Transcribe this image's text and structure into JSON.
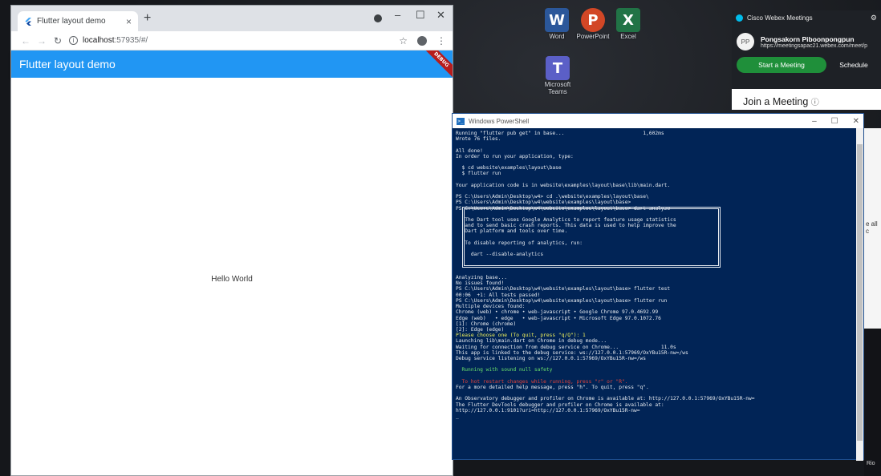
{
  "chrome": {
    "tab_title": "Flutter layout demo",
    "tab_close": "×",
    "new_tab": "+",
    "url_host": "localhost",
    "url_rest": ":57935/#/",
    "star_icon": "☆",
    "menu_icon": "⋮",
    "minimize": "–",
    "maximize": "☐",
    "close": "✕"
  },
  "app": {
    "title": "Flutter layout demo",
    "debug_banner": "DEBUG",
    "body_text": "Hello World",
    "colors": {
      "app_bar": "#2196f3",
      "debug_banner": "#b71c1c"
    }
  },
  "desktop_icons": [
    {
      "label": "Word",
      "letter": "W",
      "color": "#2b579a"
    },
    {
      "label": "PowerPoint",
      "letter": "P",
      "color": "#d24726"
    },
    {
      "label": "Excel",
      "letter": "X",
      "color": "#217346"
    },
    {
      "label": "Microsoft Teams",
      "letter": "T",
      "color": "#5b5fc7"
    }
  ],
  "webex": {
    "title": "Cisco Webex Meetings",
    "avatar_initials": "PP",
    "user_name": "Pongsakorn Piboonpongpun",
    "meeting_link": "https://meetingsapac21.webex.com/meet/p",
    "start_button": "Start a Meeting",
    "schedule_button": "Schedule",
    "join_heading": "Join a Meeting"
  },
  "powershell": {
    "title": "Windows PowerShell",
    "lines": [
      {
        "text": "Running \"flutter pub get\" in base...                          1,602ms",
        "style": ""
      },
      {
        "text": "Wrote 76 files.",
        "style": ""
      },
      {
        "text": "",
        "style": ""
      },
      {
        "text": "All done!",
        "style": ""
      },
      {
        "text": "In order to run your application, type:",
        "style": ""
      },
      {
        "text": "",
        "style": ""
      },
      {
        "text": "  $ cd website\\examples\\layout\\base",
        "style": ""
      },
      {
        "text": "  $ flutter run",
        "style": ""
      },
      {
        "text": "",
        "style": ""
      },
      {
        "text": "Your application code is in website\\examples\\layout\\base\\lib\\main.dart.",
        "style": ""
      },
      {
        "text": "",
        "style": ""
      },
      {
        "text": "PS C:\\Users\\Admin\\Desktop\\w4> cd .\\website\\examples\\layout\\base\\",
        "style": ""
      },
      {
        "text": "PS C:\\Users\\Admin\\Desktop\\w4\\website\\examples\\layout\\base>",
        "style": ""
      },
      {
        "text": "PS C:\\Users\\Admin\\Desktop\\w4\\website\\examples\\layout\\base> dart analyze",
        "style": ""
      },
      {
        "text": "",
        "style": ""
      },
      {
        "text": "   The Dart tool uses Google Analytics to report feature usage statistics",
        "style": ""
      },
      {
        "text": "   and to send basic crash reports. This data is used to help improve the",
        "style": ""
      },
      {
        "text": "   Dart platform and tools over time.",
        "style": ""
      },
      {
        "text": "",
        "style": ""
      },
      {
        "text": "   To disable reporting of analytics, run:",
        "style": ""
      },
      {
        "text": "",
        "style": ""
      },
      {
        "text": "     dart --disable-analytics",
        "style": ""
      },
      {
        "text": "",
        "style": ""
      },
      {
        "text": "",
        "style": ""
      },
      {
        "text": "",
        "style": ""
      },
      {
        "text": "Analyzing base...",
        "style": ""
      },
      {
        "text": "No issues found!",
        "style": ""
      },
      {
        "text": "PS C:\\Users\\Admin\\Desktop\\w4\\website\\examples\\layout\\base> flutter test",
        "style": ""
      },
      {
        "text": "00:06  +1: All tests passed!",
        "style": ""
      },
      {
        "text": "PS C:\\Users\\Admin\\Desktop\\w4\\website\\examples\\layout\\base> flutter run",
        "style": ""
      },
      {
        "text": "Multiple devices found:",
        "style": ""
      },
      {
        "text": "Chrome (web) • chrome • web-javascript • Google Chrome 97.0.4692.99",
        "style": ""
      },
      {
        "text": "Edge (web)   • edge   • web-javascript • Microsoft Edge 97.0.1072.76",
        "style": ""
      },
      {
        "text": "[1]: Chrome (chrome)",
        "style": ""
      },
      {
        "text": "[2]: Edge (edge)",
        "style": ""
      },
      {
        "text": "Please choose one (To quit, press \"q/Q\"): 1",
        "style": "yellow"
      },
      {
        "text": "Launching lib\\main.dart on Chrome in debug mode...",
        "style": ""
      },
      {
        "text": "Waiting for connection from debug service on Chrome...              11.0s",
        "style": ""
      },
      {
        "text": "This app is linked to the debug service: ws://127.0.0.1:57969/OxYBu15R-nw=/ws",
        "style": ""
      },
      {
        "text": "Debug service listening on ws://127.0.0.1:57969/OxYBu15R-nw=/ws",
        "style": ""
      },
      {
        "text": "",
        "style": ""
      },
      {
        "text": "  Running with sound null safety",
        "style": "green"
      },
      {
        "text": "",
        "style": ""
      },
      {
        "text": "  To hot restart changes while running, press \"r\" or \"R\".",
        "style": "red"
      },
      {
        "text": "For a more detailed help message, press \"h\". To quit, press \"q\".",
        "style": ""
      },
      {
        "text": "",
        "style": ""
      },
      {
        "text": "An Observatory debugger and profiler on Chrome is available at: http://127.0.0.1:57969/OxYBu15R-nw=",
        "style": ""
      },
      {
        "text": "The Flutter DevTools debugger and profiler on Chrome is available at:",
        "style": ""
      },
      {
        "text": "http://127.0.0.1:9101?uri=http://127.0.0.1:57969/OxYBu15R-nw=",
        "style": ""
      },
      {
        "text": "_",
        "style": ""
      }
    ]
  },
  "desktop_fragments": [
    {
      "text": "e all c"
    },
    {
      "text": "Rio"
    }
  ]
}
